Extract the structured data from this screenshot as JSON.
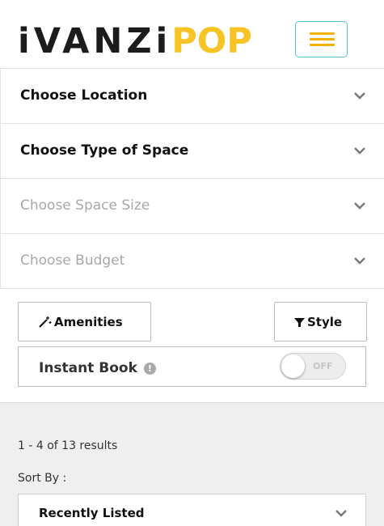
{
  "header": {
    "logo_dark": "iVANZi",
    "logo_gold": "POP",
    "menu_icon": "hamburger-icon"
  },
  "filters": [
    {
      "label": "Choose Location",
      "active": true
    },
    {
      "label": "Choose Type of Space",
      "active": true
    },
    {
      "label": "Choose Space Size",
      "active": false
    },
    {
      "label": "Choose Budget",
      "active": false
    }
  ],
  "buttons": {
    "amenities": "Amenities",
    "amenities_icon": "magic-wand-icon",
    "style": "Style",
    "style_icon": "filter-icon"
  },
  "instant_book": {
    "label": "Instant Book",
    "info_icon": "!",
    "toggle_state": "OFF"
  },
  "results": {
    "count_text": "1 - 4 of 13 results",
    "sort_label": "Sort By :",
    "sort_value": "Recently Listed"
  },
  "colors": {
    "brand_gold": "#f7c325",
    "menu_border": "#5bc0de",
    "muted_text": "#a8a8a8",
    "results_bg": "#efefef"
  }
}
